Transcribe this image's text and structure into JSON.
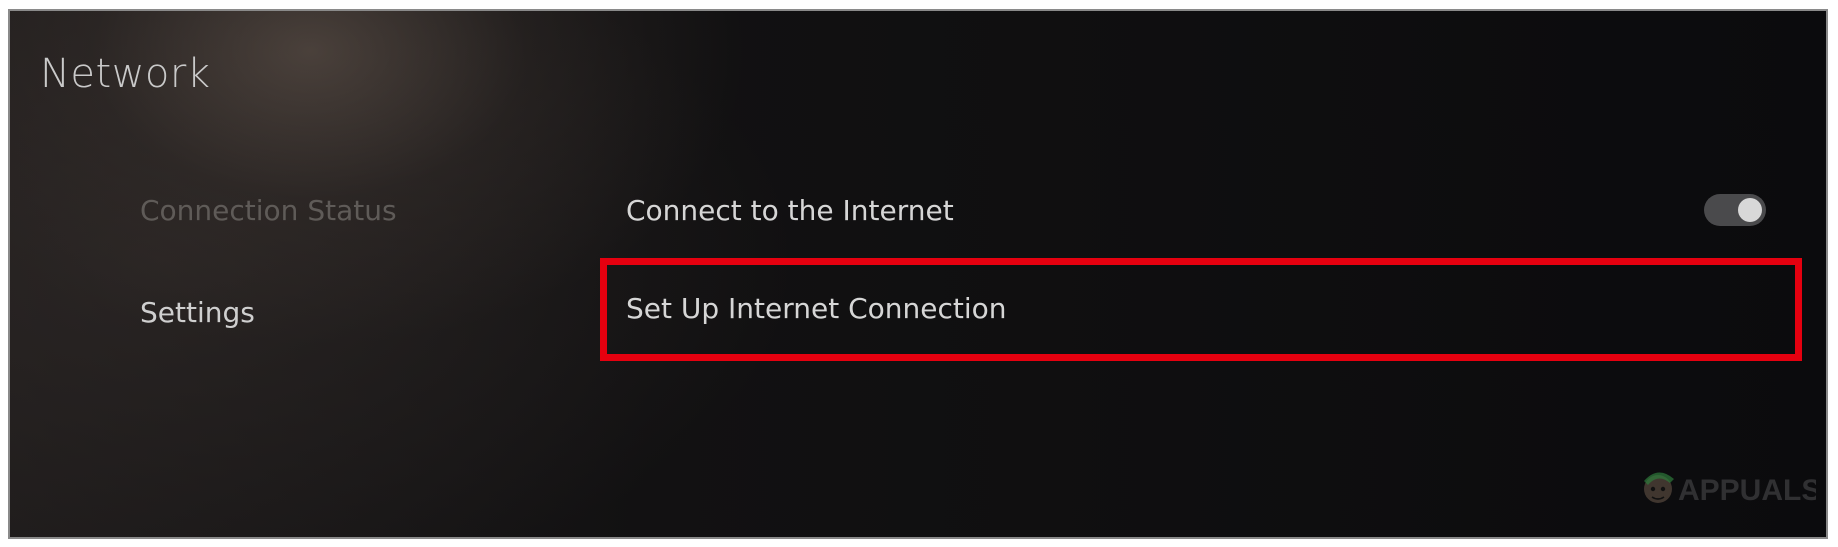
{
  "page": {
    "title": "Network"
  },
  "sidebar": {
    "items": [
      {
        "label": "Connection Status",
        "state": "dimmed"
      },
      {
        "label": "Settings",
        "state": "active"
      }
    ]
  },
  "settings": {
    "rows": [
      {
        "label": "Connect to the Internet",
        "toggle": "on"
      },
      {
        "label": "Set Up Internet Connection",
        "highlighted": true
      }
    ]
  },
  "annotation": {
    "highlight_color": "#e5000f"
  },
  "watermark": {
    "text": "APPUALS",
    "icon": "mascot-icon"
  }
}
